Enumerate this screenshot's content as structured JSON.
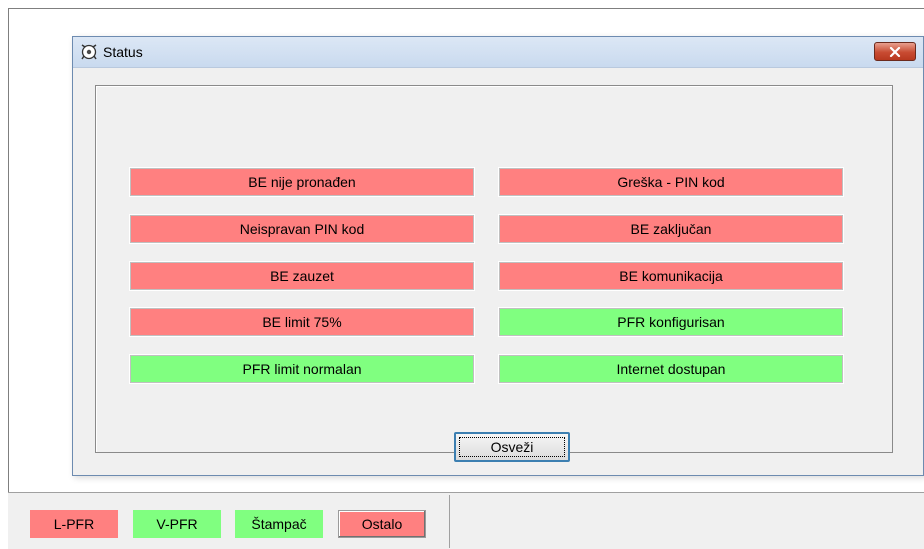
{
  "dialog": {
    "title": "Status",
    "refresh_label": "Osveži"
  },
  "indicators": [
    {
      "label": "BE nije pronađen",
      "state": "error"
    },
    {
      "label": "Greška - PIN kod",
      "state": "error"
    },
    {
      "label": "Neispravan PIN kod",
      "state": "error"
    },
    {
      "label": "BE zaključan",
      "state": "error"
    },
    {
      "label": "BE zauzet",
      "state": "error"
    },
    {
      "label": "BE komunikacija",
      "state": "error"
    },
    {
      "label": "BE limit 75%",
      "state": "error"
    },
    {
      "label": "PFR konfigurisan",
      "state": "ok"
    },
    {
      "label": "PFR limit normalan",
      "state": "ok"
    },
    {
      "label": "Internet dostupan",
      "state": "ok"
    }
  ],
  "bottom_bar": {
    "items": [
      {
        "label": "L-PFR",
        "state": "error"
      },
      {
        "label": "V-PFR",
        "state": "ok"
      },
      {
        "label": "Štampač",
        "state": "ok"
      },
      {
        "label": "Ostalo",
        "state": "error"
      }
    ]
  },
  "colors": {
    "error": "#ff8080",
    "ok": "#80ff80",
    "focus_border": "#3c7fb1"
  },
  "icons": {
    "title": "app-status-icon",
    "close": "close-icon"
  }
}
